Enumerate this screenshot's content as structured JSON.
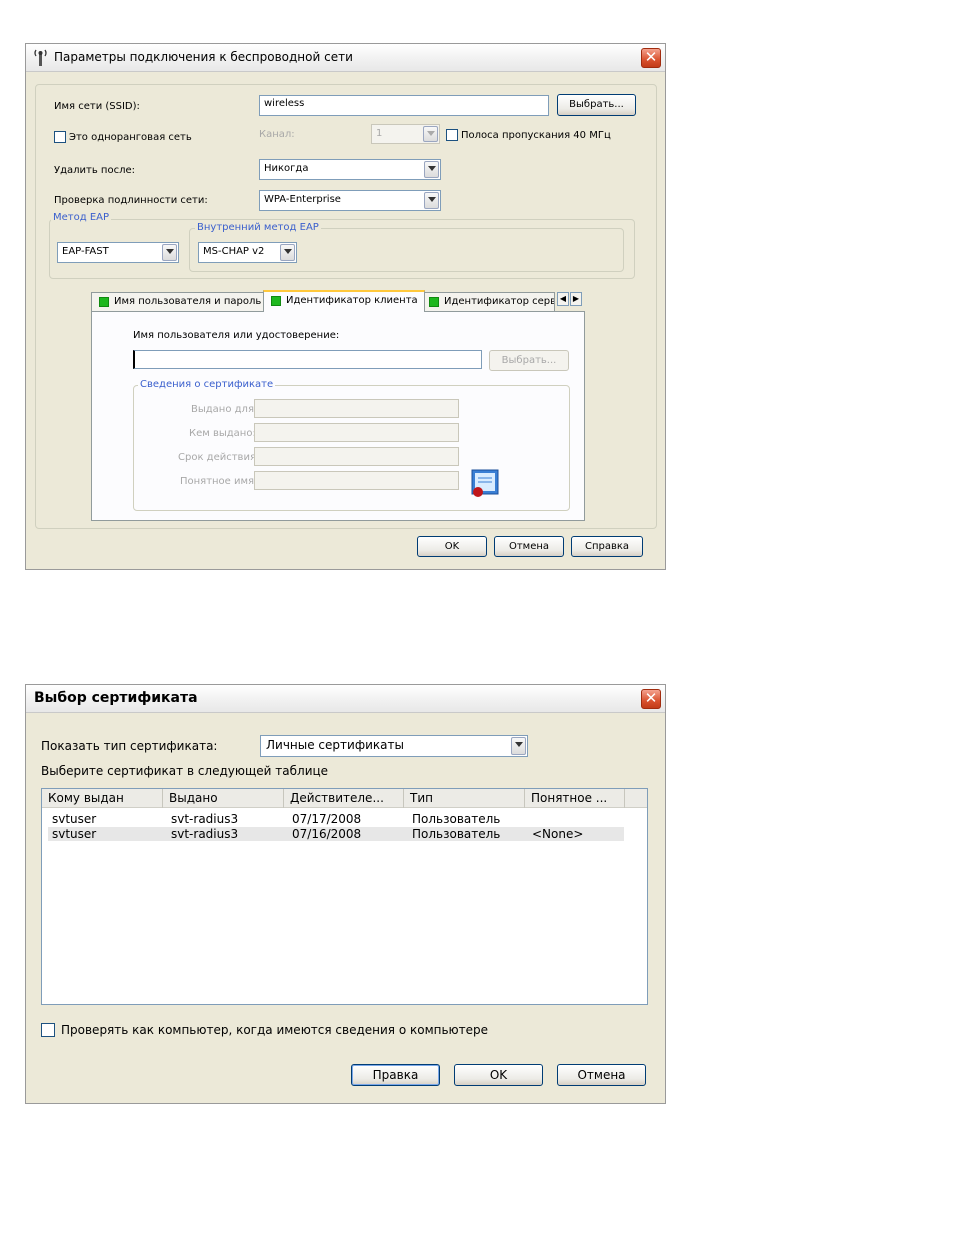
{
  "dialog1": {
    "title": "Параметры подключения к беспроводной сети",
    "ssid_label": "Имя сети (SSID):",
    "ssid_value": "wireless",
    "select_button": "Выбрать...",
    "adhoc_label": "Это одноранговая сеть",
    "channel_label": "Канал:",
    "channel_value": "1",
    "bandwidth_label": "Полоса пропускания 40 МГц",
    "delete_after_label": "Удалить после:",
    "delete_after_value": "Никогда",
    "auth_label": "Проверка подлинности сети:",
    "auth_value": "WPA-Enterprise",
    "eap_group": "Метод EAP",
    "eap_value": "EAP-FAST",
    "inner_eap_group": "Внутренний метод EAP",
    "inner_eap_value": "MS-CHAP v2",
    "tabs": [
      {
        "label": "Имя пользователя и пароль"
      },
      {
        "label": "Идентификатор клиента"
      },
      {
        "label": "Идентификатор сервер"
      }
    ],
    "user_cert_label": "Имя пользователя или удостоверение:",
    "user_cert_value": "",
    "select_button2": "Выбрать...",
    "cert_group": "Сведения о сертификате",
    "issued_to_label": "Выдано для:",
    "issued_by_label": "Кем выдано:",
    "expires_label": "Срок действия:",
    "friendly_name_label": "Понятное имя:",
    "ok": "OK",
    "cancel": "Отмена",
    "help": "Справка"
  },
  "dialog2": {
    "title": "Выбор сертификата",
    "show_type_label": "Показать тип сертификата:",
    "show_type_value": "Личные сертификаты",
    "choose_label": "Выберите сертификат в следующей таблице",
    "columns": [
      "Кому выдан",
      "Выдано",
      "Действителе...",
      "Тип",
      "Понятное ..."
    ],
    "rows": [
      {
        "issued_to": "svtuser",
        "issued_by": "svt-radius3",
        "valid": "07/17/2008",
        "type": "Пользователь",
        "friendly": ""
      },
      {
        "issued_to": "svtuser",
        "issued_by": "svt-radius3",
        "valid": "07/16/2008",
        "type": "Пользователь",
        "friendly": "<None>"
      }
    ],
    "verify_label": "Проверять как компьютер, когда имеются сведения о компьютере",
    "edit": "Правка",
    "ok": "OK",
    "cancel": "Отмена"
  },
  "colors": {
    "accent_blue": "#3a5fcd",
    "tab_green": "#1fb81f",
    "close_red": "#d9522f"
  }
}
